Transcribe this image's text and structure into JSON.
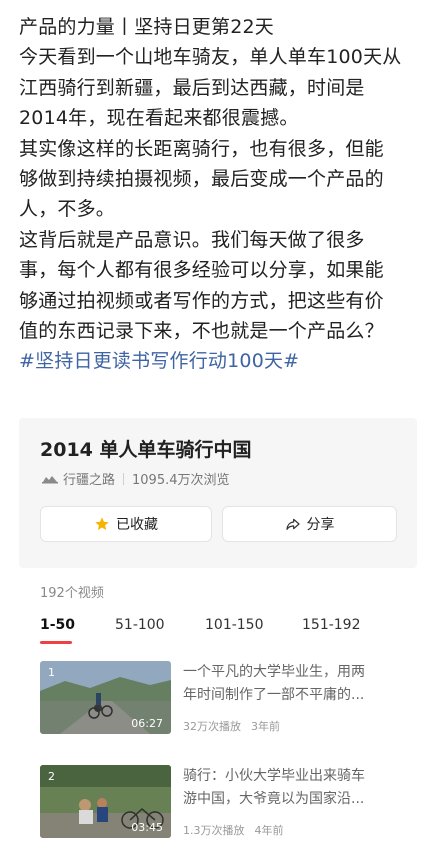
{
  "post": {
    "lines": [
      "产品的力量丨坚持日更第22天",
      "今天看到一个山地车骑友，单人单车100天从",
      "江西骑行到新疆，最后到达西藏，时间是",
      "2014年，现在看起来都很震撼。",
      "其实像这样的长距离骑行，也有很多，但能",
      "够做到持续拍摄视频，最后变成一个产品的",
      "人，不多。",
      "这背后就是产品意识。我们每天做了很多",
      "事，每个人都有很多经验可以分享，如果能",
      "够通过拍视频或者写作的方式，把这些有价",
      "值的东西记录下来，不也就是一个产品么？"
    ],
    "hashtag": "#坚持日更读书写作行动100天#"
  },
  "collection": {
    "title": "2014 单人单车骑行中国",
    "author": "行疆之路",
    "views": "1095.4万次浏览",
    "favorite_label": "已收藏",
    "share_label": "分享",
    "video_count": "192个视频",
    "tabs": [
      "1-50",
      "51-100",
      "101-150",
      "151-192"
    ],
    "active_tab": "1-50",
    "videos": [
      {
        "index": "1",
        "duration": "06:27",
        "title_line1": "一个平凡的大学毕业生，用两",
        "title_line2": "年时间制作了一部不平庸的...",
        "plays": "32万次播放",
        "age": "3年前"
      },
      {
        "index": "2",
        "duration": "03:45",
        "title_line1": "骑行：小伙大学毕业出来骑车",
        "title_line2": "游中国，大爷竟以为国家沿...",
        "plays": "1.3万次播放",
        "age": "4年前"
      }
    ]
  },
  "colors": {
    "text": "#222222",
    "hashtag": "#3f63a3",
    "muted": "#777777",
    "tab_accent": "#f04142",
    "star": "#f5b400",
    "card_bg": "#f6f6f6"
  },
  "icons": [
    "route-icon",
    "star-icon",
    "share-icon"
  ]
}
